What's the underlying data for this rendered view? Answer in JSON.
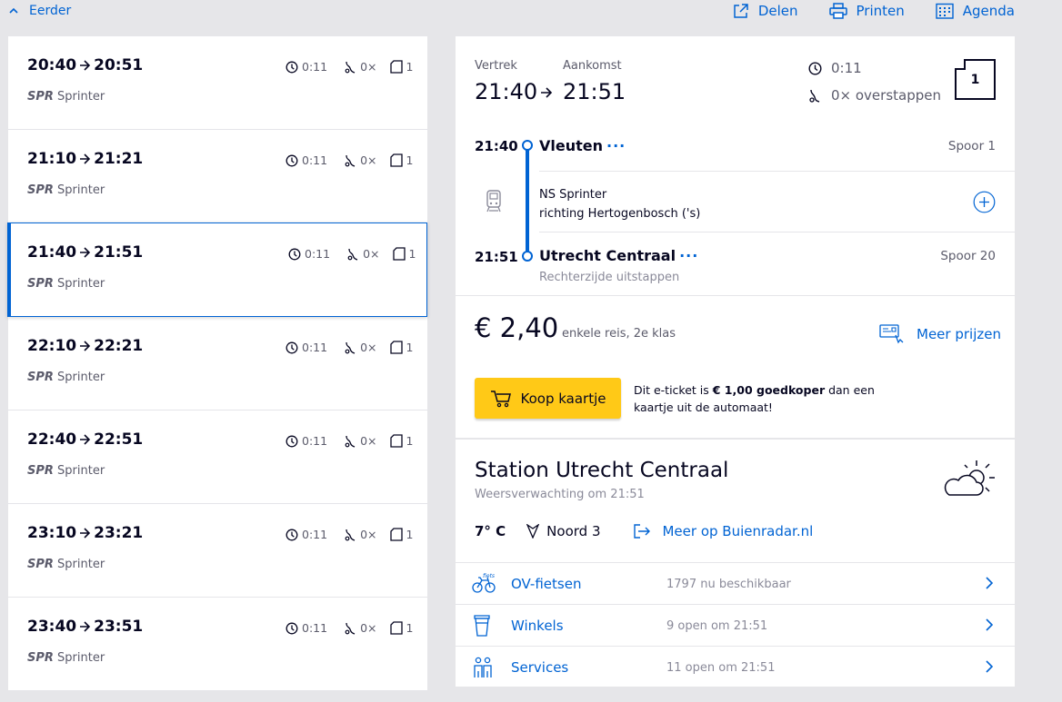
{
  "topbar": {
    "earlier_label": "Eerder",
    "share_label": "Delen",
    "print_label": "Printen",
    "agenda_label": "Agenda"
  },
  "trips": [
    {
      "dep": "20:40",
      "arr": "20:51",
      "type_code": "SPR",
      "type_name": "Sprinter",
      "duration": "0:11",
      "transfers": "0×",
      "crowd": "1",
      "selected": false
    },
    {
      "dep": "21:10",
      "arr": "21:21",
      "type_code": "SPR",
      "type_name": "Sprinter",
      "duration": "0:11",
      "transfers": "0×",
      "crowd": "1",
      "selected": false
    },
    {
      "dep": "21:40",
      "arr": "21:51",
      "type_code": "SPR",
      "type_name": "Sprinter",
      "duration": "0:11",
      "transfers": "0×",
      "crowd": "1",
      "selected": true
    },
    {
      "dep": "22:10",
      "arr": "22:21",
      "type_code": "SPR",
      "type_name": "Sprinter",
      "duration": "0:11",
      "transfers": "0×",
      "crowd": "1",
      "selected": false
    },
    {
      "dep": "22:40",
      "arr": "22:51",
      "type_code": "SPR",
      "type_name": "Sprinter",
      "duration": "0:11",
      "transfers": "0×",
      "crowd": "1",
      "selected": false
    },
    {
      "dep": "23:10",
      "arr": "23:21",
      "type_code": "SPR",
      "type_name": "Sprinter",
      "duration": "0:11",
      "transfers": "0×",
      "crowd": "1",
      "selected": false
    },
    {
      "dep": "23:40",
      "arr": "23:51",
      "type_code": "SPR",
      "type_name": "Sprinter",
      "duration": "0:11",
      "transfers": "0×",
      "crowd": "1",
      "selected": false
    }
  ],
  "detail": {
    "departure_label": "Vertrek",
    "arrival_label": "Aankomst",
    "departure_time": "21:40",
    "arrival_time": "21:51",
    "duration": "0:11",
    "transfers_text": "0× overstappen",
    "crowd_level": "1",
    "from": {
      "time": "21:40",
      "name": "Vleuten",
      "track": "Spoor 1"
    },
    "train": {
      "name": "NS Sprinter",
      "direction": "richting Hertogenbosch ('s)"
    },
    "to": {
      "time": "21:51",
      "name": "Utrecht Centraal",
      "track": "Spoor 20",
      "note": "Rechterzijde uitstappen"
    },
    "price": "€ 2,40",
    "price_note": "enkele reis, 2e klas",
    "more_prices_label": "Meer prijzen",
    "buy_label": "Koop kaartje",
    "buy_note_pre": "Dit e-ticket is ",
    "buy_note_bold": "€ 1,00 goedkoper",
    "buy_note_post": " dan een kaartje uit de automaat!"
  },
  "station": {
    "title": "Station Utrecht Centraal",
    "forecast_label": "Weersverwachting om 21:51",
    "temperature": "7° C",
    "wind": "Noord 3",
    "buienradar_label": "Meer op Buienradar.nl",
    "rows": [
      {
        "name": "OV-fietsen",
        "availability": "1797 nu beschikbaar",
        "icon": "bicycle-icon"
      },
      {
        "name": "Winkels",
        "availability": "9 open om 21:51",
        "icon": "cup-icon"
      },
      {
        "name": "Services",
        "availability": "11 open om 21:51",
        "icon": "people-icon"
      }
    ]
  },
  "colors": {
    "accent": "#0063d3",
    "dark": "#070721",
    "yellow": "#ffc917",
    "background": "#e6e6e9"
  }
}
